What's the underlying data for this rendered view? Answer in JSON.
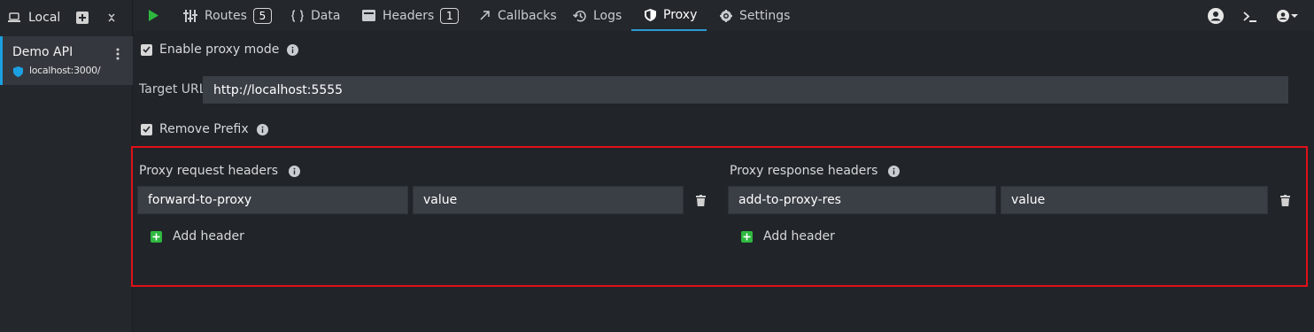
{
  "sidebar": {
    "env_label": "Local",
    "items": [
      {
        "name": "Demo API",
        "host": "localhost:3000/"
      }
    ]
  },
  "nav": {
    "tabs": [
      {
        "label": "Routes",
        "badge": "5"
      },
      {
        "label": "Data"
      },
      {
        "label": "Headers",
        "badge": "1"
      },
      {
        "label": "Callbacks"
      },
      {
        "label": "Logs"
      },
      {
        "label": "Proxy",
        "active": true
      },
      {
        "label": "Settings"
      }
    ]
  },
  "proxy": {
    "enable_label": "Enable proxy mode",
    "enable_checked": true,
    "target_label": "Target URL",
    "target_value": "http://localhost:5555",
    "remove_prefix_label": "Remove Prefix",
    "remove_prefix_checked": true,
    "request_headers": {
      "title": "Proxy request headers",
      "rows": [
        {
          "key": "forward-to-proxy",
          "value": "value"
        }
      ],
      "add_label": "Add header"
    },
    "response_headers": {
      "title": "Proxy response headers",
      "rows": [
        {
          "key": "add-to-proxy-res",
          "value": "value"
        }
      ],
      "add_label": "Add header"
    }
  },
  "colors": {
    "accent": "#2c9ad6",
    "highlight_border": "#e0101a",
    "add_green": "#2eb83f",
    "play_green": "#2eb83f"
  }
}
